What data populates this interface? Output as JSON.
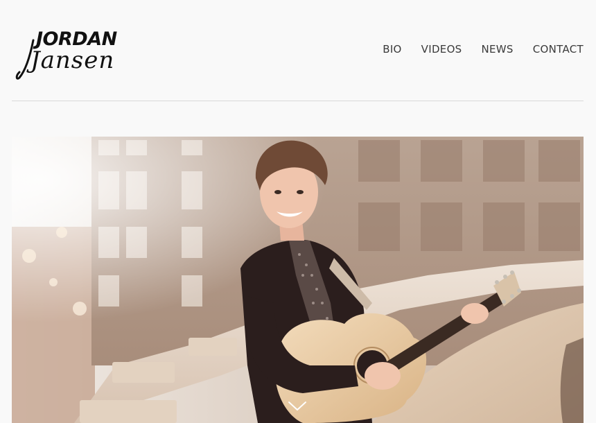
{
  "brand": {
    "logo_text_line1": "JORDAN",
    "logo_text_line2": "Jansen"
  },
  "nav": {
    "items": [
      {
        "label": "BIO"
      },
      {
        "label": "VIDEOS"
      },
      {
        "label": "NEWS"
      },
      {
        "label": "CONTACT"
      }
    ]
  },
  "hero": {
    "subject": "guitarist-on-bridge-photo",
    "scroll_icon": "chevron-down-icon"
  },
  "colors": {
    "background": "#f9f9f9",
    "nav_text": "#3a3a3a",
    "divider": "#d9d9d9",
    "logo": "#111111"
  }
}
